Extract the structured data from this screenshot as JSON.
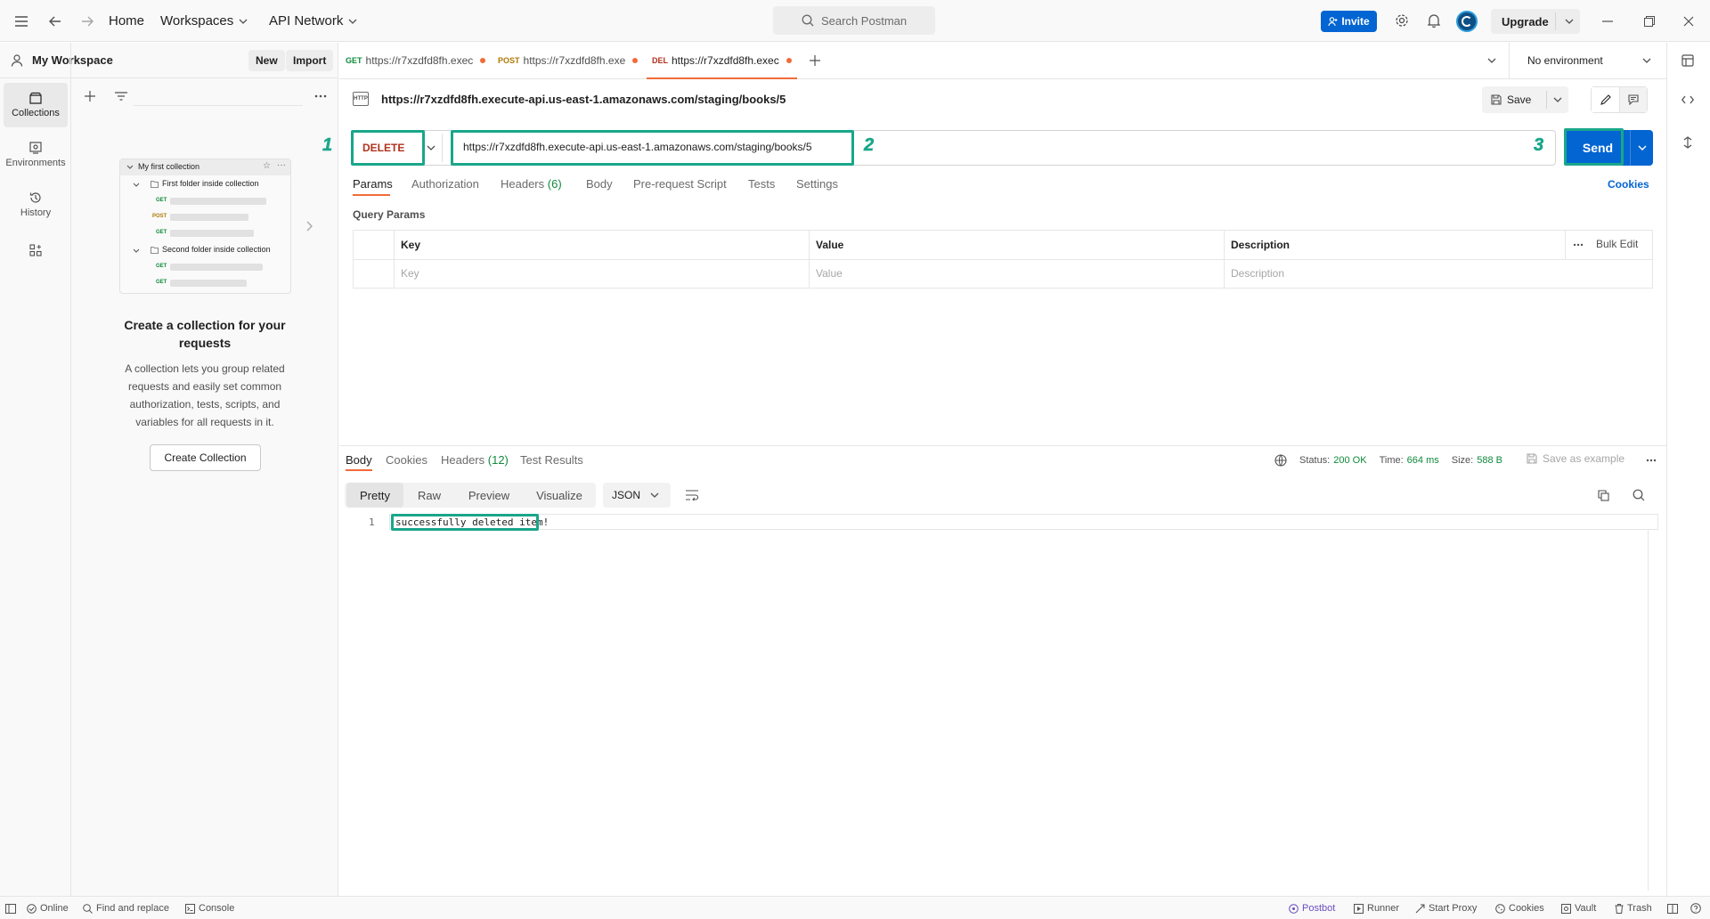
{
  "topbar": {
    "home": "Home",
    "workspaces": "Workspaces",
    "api_network": "API Network",
    "search_placeholder": "Search Postman",
    "invite": "Invite",
    "upgrade": "Upgrade"
  },
  "workspace": {
    "name": "My Workspace",
    "new_label": "New",
    "import_label": "Import"
  },
  "rail": [
    {
      "label": "Collections",
      "icon": "collections-icon"
    },
    {
      "label": "Environments",
      "icon": "environments-icon"
    },
    {
      "label": "History",
      "icon": "history-icon"
    }
  ],
  "empty_state": {
    "illustration": {
      "collection": "My first collection",
      "folder1": "First folder inside collection",
      "folder2": "Second folder inside collection",
      "get": "GET",
      "post": "POST"
    },
    "title": "Create a collection for your requests",
    "description": "A collection lets you group related requests and easily set common authorization, tests, scripts, and variables for all requests in it.",
    "button": "Create Collection"
  },
  "tabs": [
    {
      "method": "GET",
      "url": "https://r7xzdfd8fh.exec",
      "color": "#0f8a3c"
    },
    {
      "method": "POST",
      "url": "https://r7xzdfd8fh.exe",
      "color": "#ad7a03"
    },
    {
      "method": "DEL",
      "url": "https://r7xzdfd8fh.exec",
      "color": "#b0321e"
    }
  ],
  "environment": "No environment",
  "request": {
    "title": "https://r7xzdfd8fh.execute-api.us-east-1.amazonaws.com/staging/books/5",
    "save": "Save",
    "method": "DELETE",
    "url": "https://r7xzdfd8fh.execute-api.us-east-1.amazonaws.com/staging/books/5",
    "send": "Send",
    "callouts": [
      "1",
      "2",
      "3"
    ]
  },
  "request_tabs": {
    "params": "Params",
    "authorization": "Authorization",
    "headers": "Headers",
    "headers_count": "(6)",
    "body": "Body",
    "prerequest": "Pre-request Script",
    "tests": "Tests",
    "settings": "Settings",
    "cookies": "Cookies"
  },
  "query_params": {
    "title": "Query Params",
    "headers": [
      "Key",
      "Value",
      "Description"
    ],
    "placeholders": [
      "Key",
      "Value",
      "Description"
    ],
    "bulk_edit": "Bulk Edit"
  },
  "response": {
    "tabs": {
      "body": "Body",
      "cookies": "Cookies",
      "headers": "Headers",
      "headers_count": "(12)",
      "test_results": "Test Results"
    },
    "status_label": "Status:",
    "status": "200 OK",
    "time_label": "Time:",
    "time": "664 ms",
    "size_label": "Size:",
    "size": "588 B",
    "save_example": "Save as example",
    "views": [
      "Pretty",
      "Raw",
      "Preview",
      "Visualize"
    ],
    "format": "JSON",
    "line_number": "1",
    "body_text": "successfully deleted item!"
  },
  "statusbar": {
    "online": "Online",
    "find_replace": "Find and replace",
    "console": "Console",
    "postbot": "Postbot",
    "runner": "Runner",
    "start_proxy": "Start Proxy",
    "cookies": "Cookies",
    "vault": "Vault",
    "trash": "Trash"
  },
  "colors": {
    "accent": "#0265d2",
    "highlight": "#1aa68a",
    "delete": "#b0321e",
    "success": "#0f8a3c"
  }
}
